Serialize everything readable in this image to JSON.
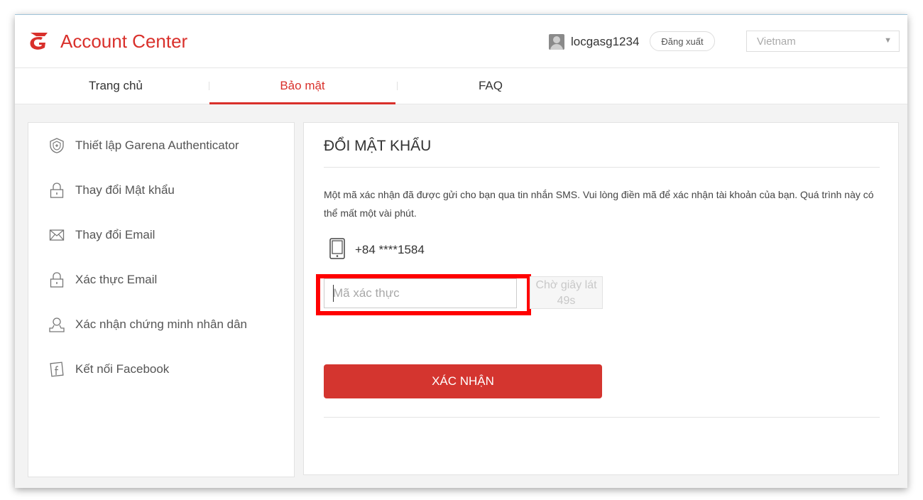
{
  "header": {
    "brand": "Account Center",
    "username": "locgasg1234",
    "logout_label": "Đăng xuất",
    "country_value": "Vietnam"
  },
  "nav": {
    "tabs": [
      {
        "label": "Trang chủ",
        "active": false
      },
      {
        "label": "Bảo mật",
        "active": true
      },
      {
        "label": "FAQ",
        "active": false
      }
    ]
  },
  "sidebar": {
    "items": [
      {
        "label": "Thiết lập Garena Authenticator",
        "icon": "shield-icon"
      },
      {
        "label": "Thay đổi Mật khẩu",
        "icon": "lock-icon"
      },
      {
        "label": "Thay đổi Email",
        "icon": "envelope-icon"
      },
      {
        "label": "Xác thực Email",
        "icon": "lock-icon"
      },
      {
        "label": "Xác nhận chứng minh nhân dân",
        "icon": "user-id-icon"
      },
      {
        "label": "Kết nối Facebook",
        "icon": "facebook-icon"
      }
    ]
  },
  "main": {
    "title": "ĐỔI MẬT KHẨU",
    "description": "Một mã xác nhận đã được gửi cho bạn qua tin nhắn SMS. Vui lòng điền mã để xác nhận tài khoản của bạn. Quá trình này có thể mất một vài phút.",
    "phone": "+84 ****1584",
    "code_placeholder": "Mã xác thực",
    "code_value": "",
    "wait_line1": "Chờ giây lát",
    "wait_line2": "49s",
    "confirm_label": "XÁC NHẬN"
  },
  "colors": {
    "brand_red": "#d9302b",
    "button_red": "#d4352f",
    "highlight_red": "#ff0000"
  }
}
